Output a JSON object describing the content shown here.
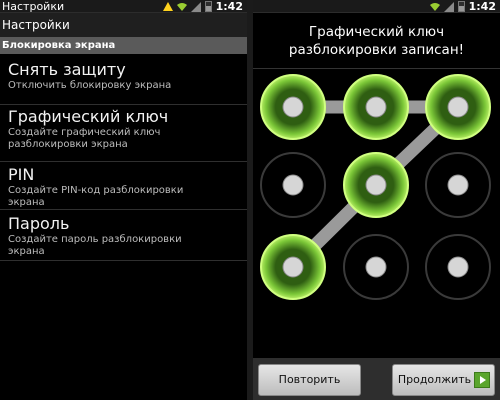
{
  "colors": {
    "accent_green": "#7cc838",
    "ring_grey": "#3a3a3a",
    "dot_grey": "#d6d6d6"
  },
  "status_bar": {
    "time": "1:42",
    "icons": [
      "alert-icon",
      "wifi-icon",
      "signal-icon",
      "battery-icon"
    ]
  },
  "settings": {
    "title": "Настройки",
    "section": "Блокировка экрана",
    "items": [
      {
        "title": "Снять защиту",
        "subtitle": "Отключить блокировку экрана"
      },
      {
        "title": "Графический ключ",
        "subtitle": "Создайте графический ключ разблокировки экрана"
      },
      {
        "title": "PIN",
        "subtitle": "Создайте PIN-код разблокировки экрана"
      },
      {
        "title": "Пароль",
        "subtitle": "Создайте пароль разблокировки экрана"
      }
    ]
  },
  "pattern": {
    "header": "Графический ключ разблокировки записан!",
    "selected_sequence": [
      1,
      2,
      3,
      5,
      7
    ],
    "buttons": {
      "retry": "Повторить",
      "continue": "Продолжить"
    }
  }
}
